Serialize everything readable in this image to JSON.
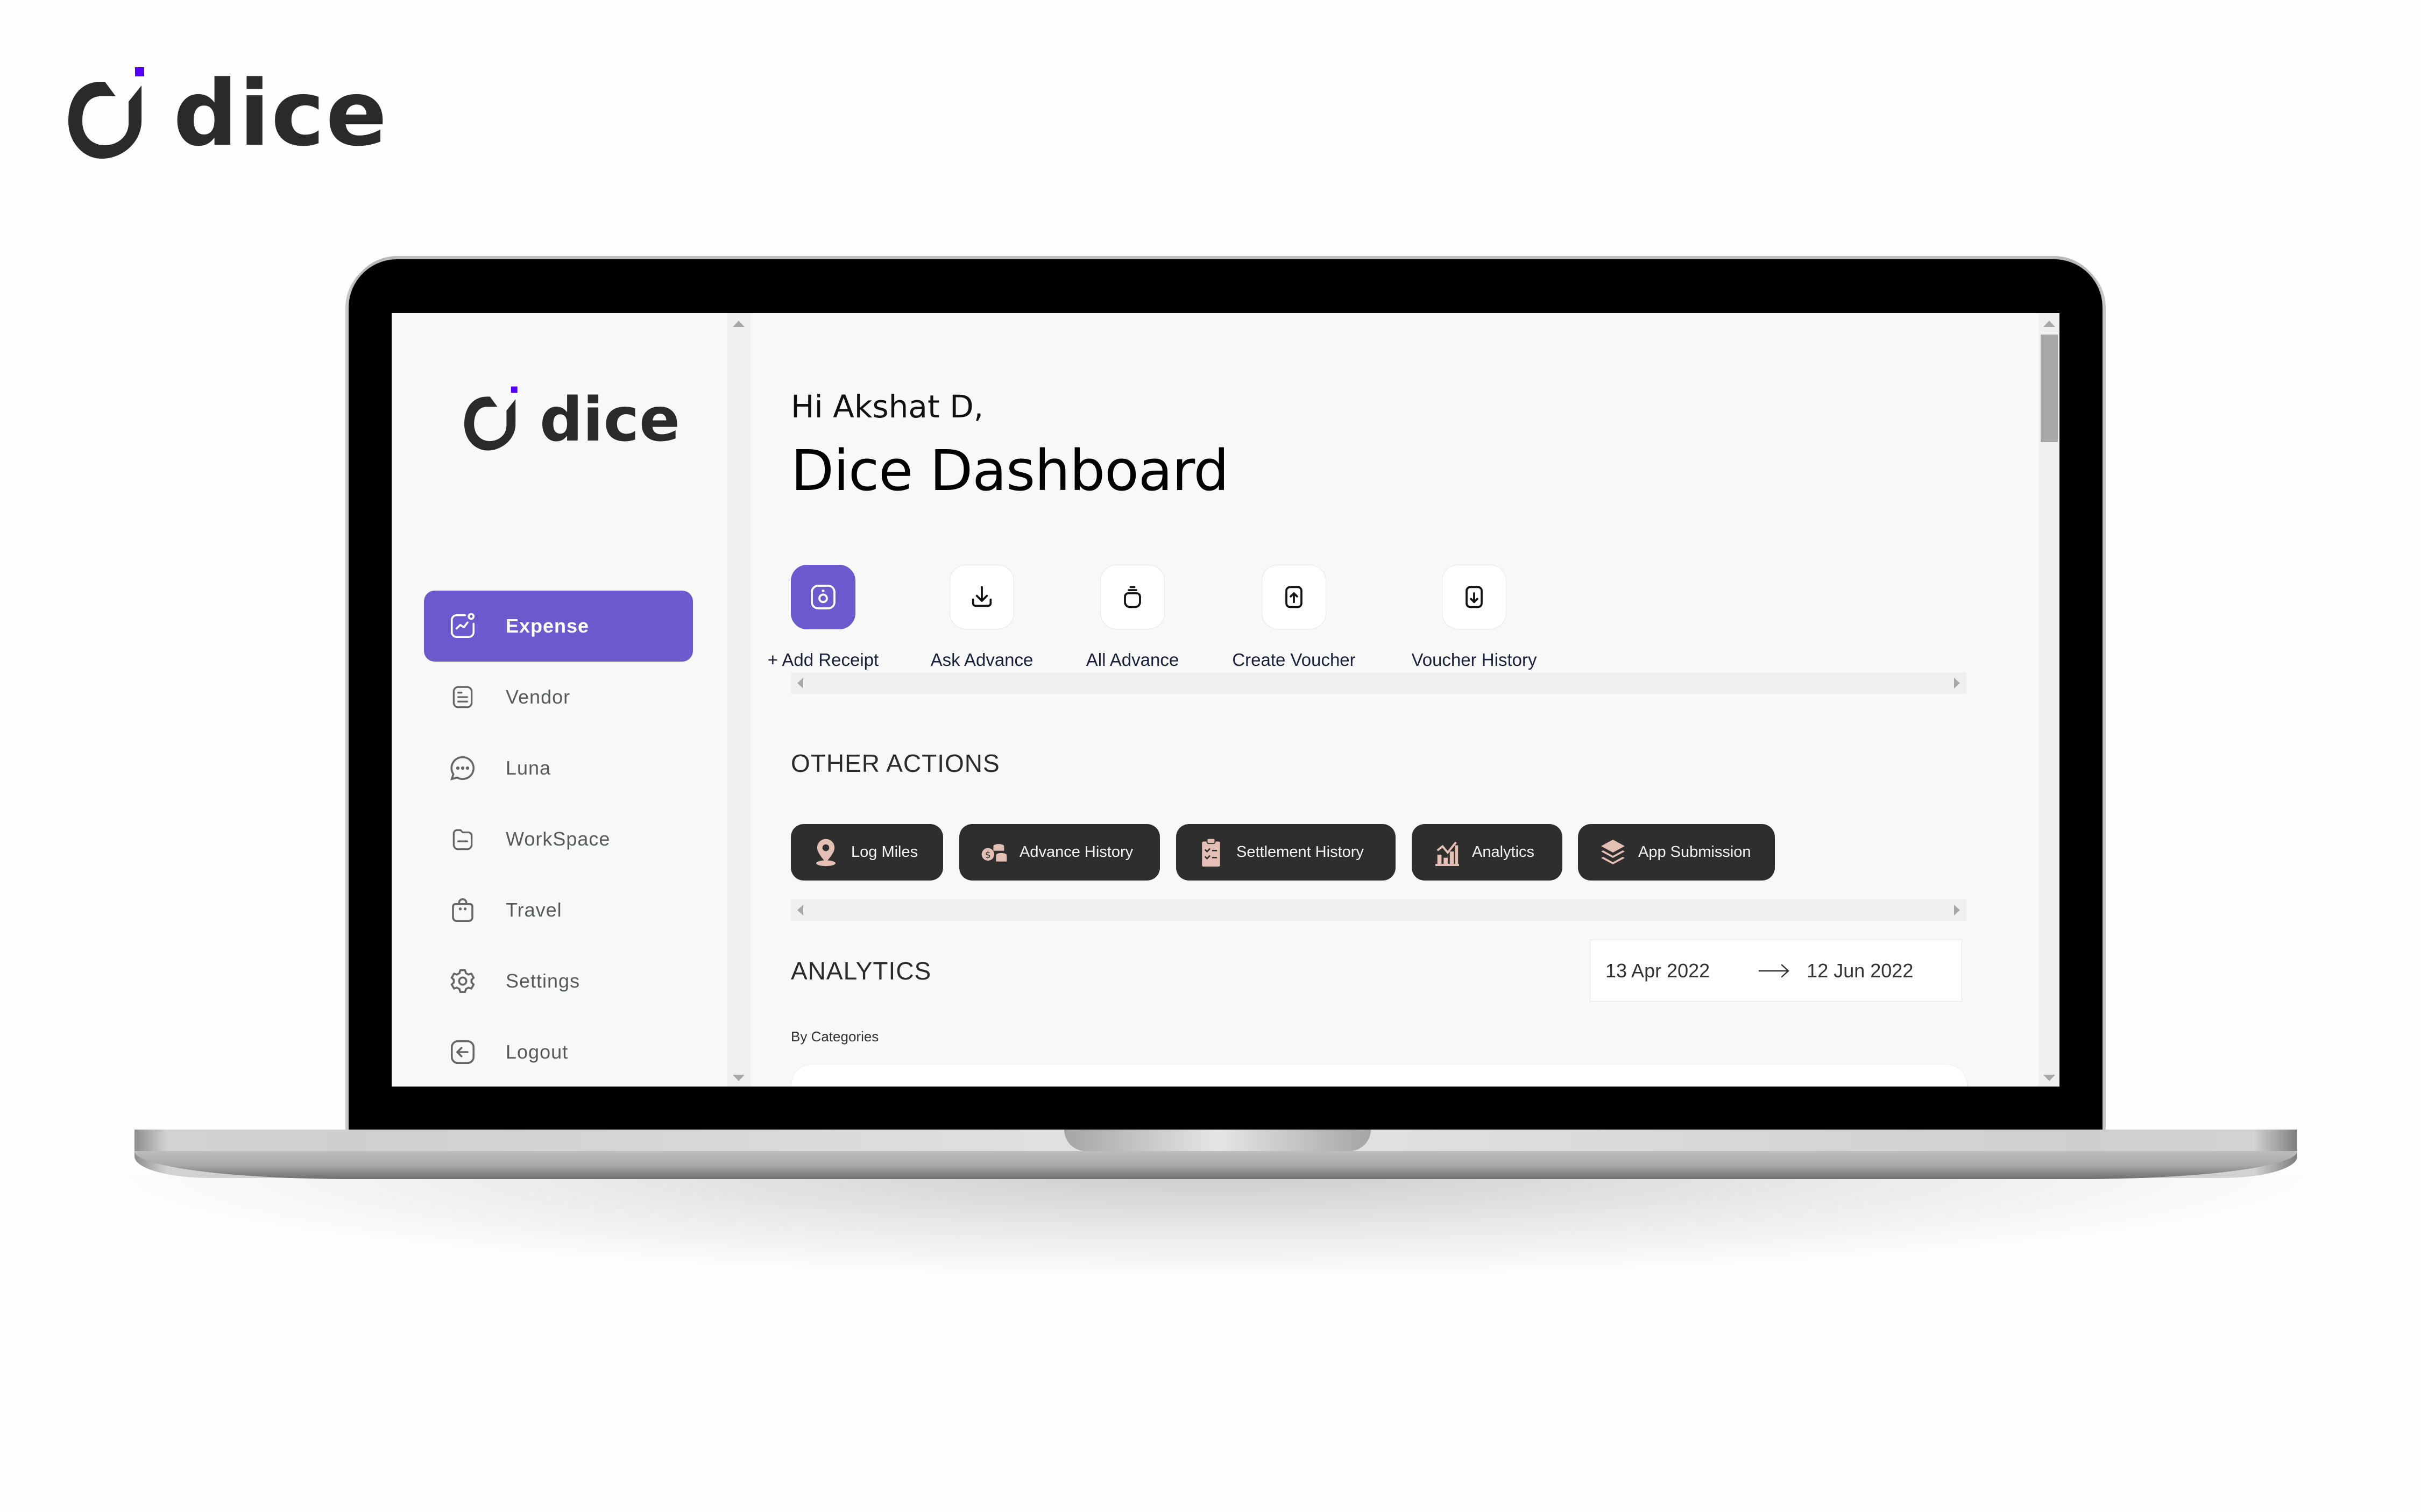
{
  "brand": {
    "name": "dice",
    "accent_color": "#5500ff"
  },
  "sidebar": {
    "logo_text": "dice",
    "items": [
      {
        "label": "Expense",
        "icon": "chart-box-icon",
        "active": true
      },
      {
        "label": "Vendor",
        "icon": "document-icon",
        "active": false
      },
      {
        "label": "Luna",
        "icon": "chat-bubble-icon",
        "active": false
      },
      {
        "label": "WorkSpace",
        "icon": "folder-icon",
        "active": false
      },
      {
        "label": "Travel",
        "icon": "bag-icon",
        "active": false
      },
      {
        "label": "Settings",
        "icon": "gear-icon",
        "active": false
      },
      {
        "label": "Logout",
        "icon": "logout-icon",
        "active": false
      }
    ],
    "active_color": "#6a5acd"
  },
  "main": {
    "greeting": "Hi Akshat D,",
    "title": "Dice Dashboard",
    "quick_actions": [
      {
        "label": "+ Add Receipt",
        "icon": "camera-icon",
        "primary": true
      },
      {
        "label": "Ask Advance",
        "icon": "download-icon",
        "primary": false
      },
      {
        "label": "All Advance",
        "icon": "jar-icon",
        "primary": false
      },
      {
        "label": "Create Voucher",
        "icon": "file-upload-icon",
        "primary": false
      },
      {
        "label": "Voucher History",
        "icon": "file-download-icon",
        "primary": false
      }
    ],
    "other_actions_heading": "OTHER ACTIONS",
    "other_actions": [
      {
        "label": "Log Miles",
        "icon": "map-pin-icon"
      },
      {
        "label": "Advance History",
        "icon": "coins-icon"
      },
      {
        "label": "Settlement History",
        "icon": "clipboard-check-icon"
      },
      {
        "label": "Analytics",
        "icon": "bar-chart-icon"
      },
      {
        "label": "App Submission",
        "icon": "layers-icon"
      }
    ],
    "analytics_heading": "ANALYTICS",
    "date_range": {
      "start": "13 Apr 2022",
      "end": "12 Jun 2022"
    },
    "by_categories_label": "By Categories"
  }
}
